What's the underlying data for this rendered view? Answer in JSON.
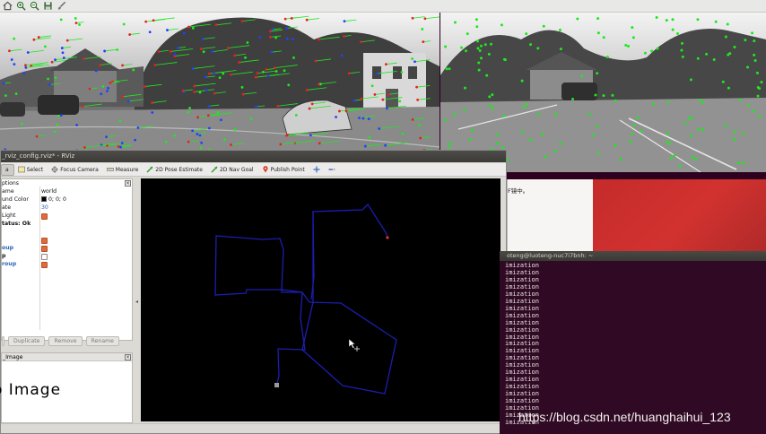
{
  "toolbar": {
    "icons": [
      "home-icon",
      "zoom-in-icon",
      "zoom-out-icon",
      "save-icon",
      "brush-icon"
    ]
  },
  "rviz": {
    "window_title": "_rviz_config.rviz* - RViz",
    "tools": [
      {
        "label": "a",
        "icon": "interact-icon",
        "active": true
      },
      {
        "label": "Select",
        "icon": "select-icon",
        "active": false
      },
      {
        "label": "Focus Camera",
        "icon": "focus-camera-icon",
        "active": false
      },
      {
        "label": "Measure",
        "icon": "measure-icon",
        "active": false
      },
      {
        "label": "2D Pose Estimate",
        "icon": "pose-estimate-icon",
        "active": false
      },
      {
        "label": "2D Nav Goal",
        "icon": "nav-goal-icon",
        "active": false
      },
      {
        "label": "Publish Point",
        "icon": "publish-point-icon",
        "active": false
      }
    ],
    "displays": {
      "options_header": "ptions",
      "rows": [
        {
          "key": "ame",
          "value": "world",
          "style": ""
        },
        {
          "key": "und Color",
          "value": "0; 0; 0",
          "style": "",
          "swatch": "#000000"
        },
        {
          "key": "ate",
          "value": "30",
          "style": "",
          "value_color": "#2c64b8"
        },
        {
          "key": "Light",
          "check": true,
          "style": ""
        },
        {
          "key": "tatus: Ok",
          "style": "bold"
        },
        {
          "key": "",
          "check": true,
          "style": ""
        },
        {
          "key": "oup",
          "check": true,
          "style": "blue"
        },
        {
          "key": "p",
          "check": false,
          "style": "bold"
        },
        {
          "key": "roup",
          "check": true,
          "style": "blue"
        }
      ]
    },
    "panel_buttons": [
      "Duplicate",
      "Remove",
      "Rename"
    ],
    "image_panel": {
      "title": "_Image",
      "placeholder": "o Image"
    }
  },
  "gedit": {
    "text": "F镜中。"
  },
  "terminal": {
    "title": "oteng@luoteng-nuc7i7bnh: ~",
    "lines": [
      "imization",
      "imization",
      "imization",
      "imization",
      "imization",
      "imization",
      "imization",
      "imization",
      "imization",
      "imization",
      "imization",
      "imization",
      "imization",
      "imization",
      "imization",
      "imization",
      "imization",
      "imization",
      "imization",
      "imization",
      "imization",
      "imization",
      "imization"
    ]
  },
  "watermark": "https://blog.csdn.net/huanghaihui_123",
  "colors": {
    "terminal_bg": "#300a24",
    "trajectory": "#1e1ea8",
    "feature_green": "#1ee81e",
    "feature_red": "#e82020",
    "feature_blue": "#2040ff",
    "desktop_red": "#c42b2b"
  }
}
